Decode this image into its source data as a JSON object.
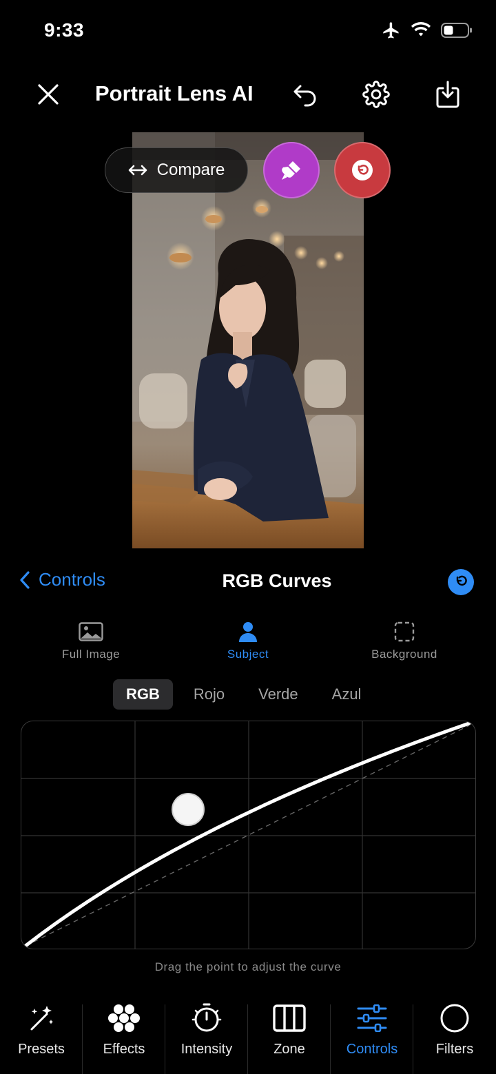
{
  "status": {
    "time": "9:33"
  },
  "app": {
    "title": "Portrait Lens AI"
  },
  "photo": {
    "compare_label": "Compare"
  },
  "controls": {
    "back_label": "Controls",
    "title": "RGB Curves"
  },
  "scopes": [
    {
      "label": "Full Image",
      "icon": "image-icon"
    },
    {
      "label": "Subject",
      "icon": "person-icon",
      "active": true
    },
    {
      "label": "Background",
      "icon": "dashed-square-icon"
    }
  ],
  "channels": [
    {
      "label": "RGB",
      "active": true
    },
    {
      "label": "Rojo"
    },
    {
      "label": "Verde"
    },
    {
      "label": "Azul"
    }
  ],
  "curve": {
    "hint": "Drag the point to adjust the curve"
  },
  "bottom_nav": [
    {
      "label": "Presets",
      "icon": "magic-wand-icon"
    },
    {
      "label": "Effects",
      "icon": "effects-dots-icon"
    },
    {
      "label": "Intensity",
      "icon": "timer-icon"
    },
    {
      "label": "Zone",
      "icon": "zone-columns-icon"
    },
    {
      "label": "Controls",
      "icon": "sliders-icon",
      "active": true
    },
    {
      "label": "Filters",
      "icon": "circle-icon"
    }
  ],
  "colors": {
    "accent": "#2f8cf5",
    "brush": "#b03bc8",
    "reset": "#c83a3f"
  }
}
